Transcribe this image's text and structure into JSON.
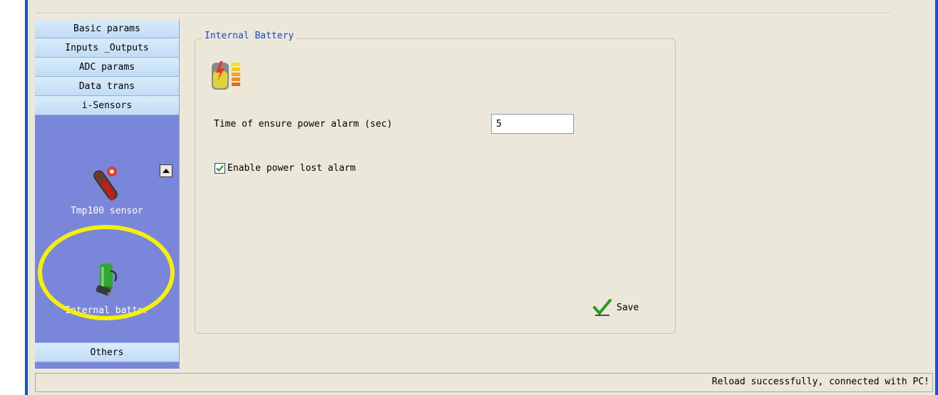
{
  "sidebar": {
    "nav_top": [
      "Basic params",
      "Inputs _Outputs",
      "ADC params",
      "Data trans",
      "i-Sensors"
    ],
    "sensors": [
      {
        "label": "Tmp100 sensor",
        "icon": "thermometer-icon"
      },
      {
        "label": "Internal batter",
        "icon": "battery-plug-icon"
      }
    ],
    "nav_bottom": "Others",
    "scroll_icon": "scroll-up-icon"
  },
  "group": {
    "title": "Internal Battery",
    "icon": "battery-level-icon",
    "alarm_time_label": "Time of ensure power alarm (sec)",
    "alarm_time_value": "5",
    "enable_alarm_label": "Enable power lost alarm",
    "enable_alarm_checked": true,
    "save_label": "Save",
    "save_icon": "checkmark-icon"
  },
  "status": {
    "text": "Reload successfully, connected with PC!"
  },
  "colors": {
    "sidebar_panel": "#7a86da",
    "nav_button": "#c9e2f8",
    "title_blue": "#1747c8",
    "highlight": "#f4f00a",
    "window_bg": "#ebe8d9"
  }
}
